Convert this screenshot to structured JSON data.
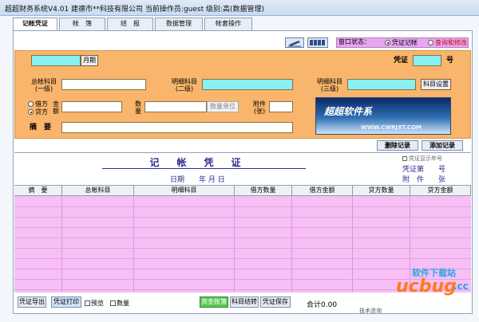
{
  "window": {
    "title": "超超财务系统V4.01 建德市**科技有限公司  当前操作员:guest  级别:高(数据管理)"
  },
  "tabs": [
    {
      "label": "记帐凭证",
      "active": true
    },
    {
      "label": "帐　簿",
      "active": false
    },
    {
      "label": "结　报",
      "active": false
    },
    {
      "label": "数据管理",
      "active": false
    },
    {
      "label": "帐套操作",
      "active": false
    }
  ],
  "toolbar": {
    "icon_pen": "pen-icon",
    "icon_grid": "grid-icon",
    "window_state_label": "窗口状态：",
    "mode_voucher_label": "凭证记帐",
    "mode_query_label": "查询和修改",
    "selected_mode": "凭证记帐"
  },
  "form": {
    "month_button": "月期",
    "voucher_label": "凭证",
    "voucher_number_unit": "号",
    "general_account_label_1": "总帐科目",
    "general_account_label_2": "(一级)",
    "detail_account_label_1": "明细科目",
    "detail_account_label_2": "(二级)",
    "detail_account3_label_1": "明细科目",
    "detail_account3_label_2": "(三级)",
    "account_setting_button": "科目设置",
    "debit_radio": "借方",
    "credit_radio": "贷方",
    "amount_label_1": "金",
    "amount_label_2": "额",
    "quantity_label_1": "数",
    "quantity_label_2": "量",
    "quantity_unit_button": "数量单位",
    "attachment_label_1": "附件",
    "attachment_label_2": "(张)",
    "summary_label": "摘　要",
    "ad_main": "超超软件系",
    "ad_url": "WWW.CWRJXT.COM"
  },
  "actions": {
    "delete_record": "删除记录",
    "add_record": "添加记录"
  },
  "voucher": {
    "title": "记帐凭证",
    "date_line": "日期　　年  月  日",
    "show_year_month": "凭证显示年号",
    "voucher_no": "凭证第　　号",
    "attachments": "附　件　　张"
  },
  "table": {
    "columns": [
      "摘　要",
      "总帐科目",
      "明细科目",
      "借方数量",
      "借方金额",
      "贷方数量",
      "贷方金额"
    ]
  },
  "bottom": {
    "export_button": "凭证导出",
    "print_button": "凭证打印",
    "preview_check": "预览",
    "quantity_check": "数量",
    "fund_change_button": "资金账簿",
    "account_transfer_button": "科目结转",
    "save_button": "凭证保存",
    "total_text": "合计0.00",
    "footnote": "技术咨询"
  },
  "watermark": {
    "line1": "软件下载站",
    "line2": "ucbug",
    "line3": ".cc"
  },
  "colors": {
    "form_bg": "#f9b56b",
    "field_cyan": "#86f2f2",
    "grid_pink": "#f7bff5",
    "title_blue": "#2c2c8e"
  }
}
